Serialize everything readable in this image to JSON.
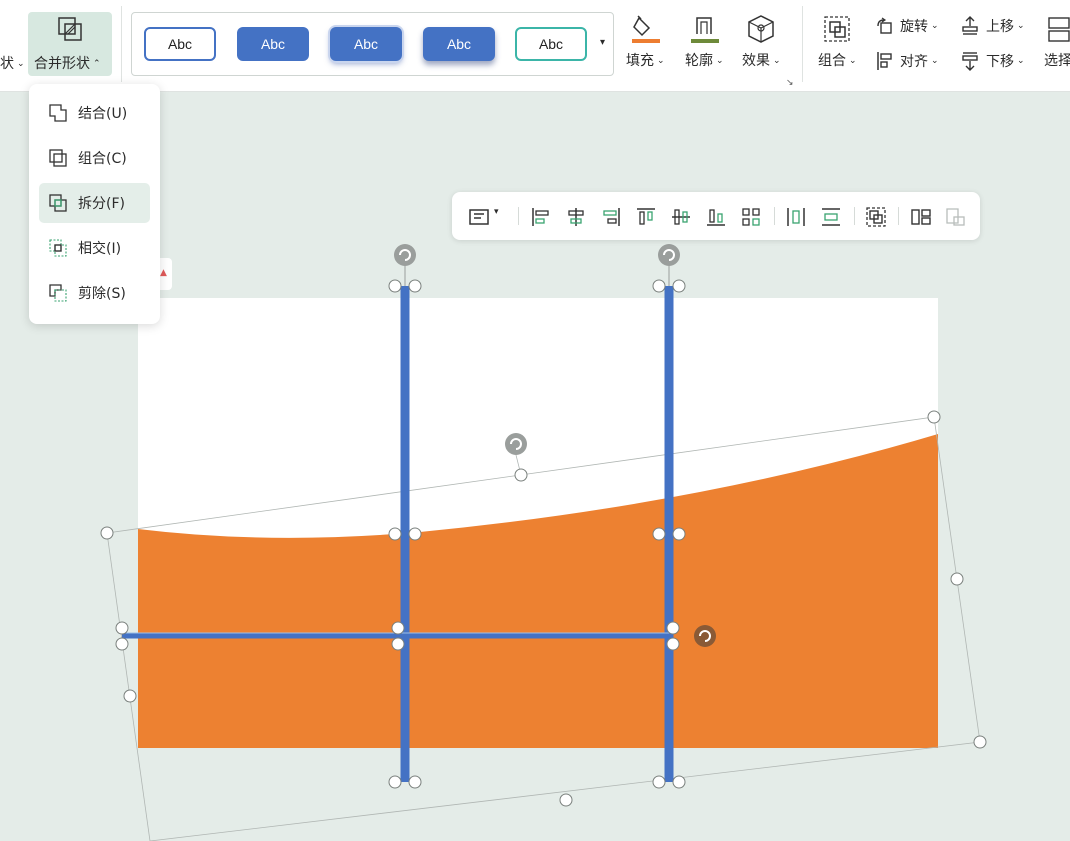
{
  "ribbon": {
    "left_cut_label": "状",
    "merge_shapes_label": "合并形状",
    "style_samples": [
      "Abc",
      "Abc",
      "Abc",
      "Abc",
      "Abc"
    ],
    "fill_label": "填充",
    "outline_label": "轮廓",
    "effects_label": "效果",
    "group_label": "组合",
    "rotate_label": "旋转",
    "align_label": "对齐",
    "bring_forward_label": "上移",
    "send_backward_label": "下移",
    "select_label": "选择"
  },
  "merge_menu": {
    "items": [
      {
        "label": "结合(U)",
        "icon": "union-icon"
      },
      {
        "label": "组合(C)",
        "icon": "combine-icon"
      },
      {
        "label": "拆分(F)",
        "icon": "fragment-icon",
        "active": true
      },
      {
        "label": "相交(I)",
        "icon": "intersect-icon"
      },
      {
        "label": "剪除(S)",
        "icon": "subtract-icon"
      }
    ]
  },
  "floating_toolbar": {
    "icons": [
      "auto-align-icon",
      "align-left-icon",
      "align-center-icon",
      "align-right-icon",
      "align-top-icon",
      "align-middle-icon",
      "align-bottom-icon",
      "distribute-grid-icon",
      "distribute-horizontal-icon",
      "distribute-vertical-icon",
      "group-objects-icon",
      "ungroup-icon",
      "selection-pane-icon"
    ]
  },
  "colors": {
    "accent": "#4472c4",
    "shape_fill": "#ed8131",
    "canvas_bg": "#e4ece8",
    "highlight": "#d7e8e0"
  }
}
